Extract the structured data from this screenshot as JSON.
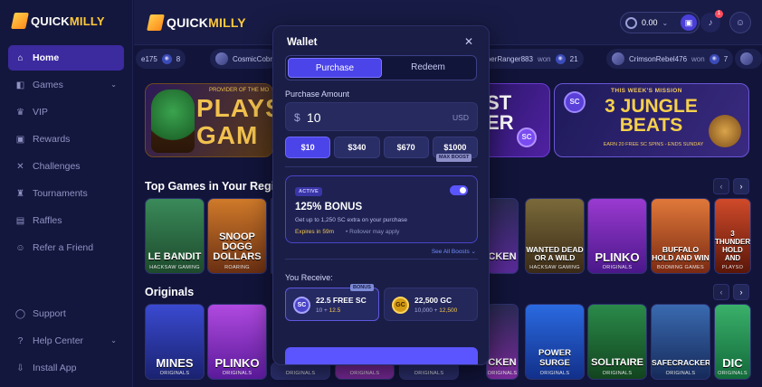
{
  "brand": {
    "name_a": "QUICK",
    "name_b": "MILLY"
  },
  "sidebar": {
    "items": [
      {
        "label": "Home",
        "icon": "home-icon"
      },
      {
        "label": "Games",
        "icon": "gamepad-icon"
      },
      {
        "label": "VIP",
        "icon": "crown-icon"
      },
      {
        "label": "Rewards",
        "icon": "gift-icon"
      },
      {
        "label": "Challenges",
        "icon": "swords-icon"
      },
      {
        "label": "Tournaments",
        "icon": "trophy-icon"
      },
      {
        "label": "Raffles",
        "icon": "ticket-icon"
      },
      {
        "label": "Refer a Friend",
        "icon": "user-plus-icon"
      }
    ],
    "bottom": [
      {
        "label": "Support",
        "icon": "chat-icon"
      },
      {
        "label": "Help Center",
        "icon": "help-icon"
      },
      {
        "label": "Install App",
        "icon": "download-icon"
      }
    ]
  },
  "topbar": {
    "balance": "0.00",
    "notification_count": "1"
  },
  "ticker": [
    {
      "user": "e175",
      "won": "won",
      "amount": "8"
    },
    {
      "user": "CosmicCobr",
      "won": "won",
      "amount": ""
    },
    {
      "user": "HyperRanger883",
      "won": "won",
      "amount": "21"
    },
    {
      "user": "CrimsonRebel476",
      "won": "won",
      "amount": "7"
    }
  ],
  "banners": {
    "b1_kicker": "PROVIDER OF THE MO",
    "b1_line1": "PLAYS",
    "b1_line2": "GAM",
    "b2_line1": "ST",
    "b2_line2": "ER",
    "b3_kicker": "THIS WEEK'S MISSION",
    "b3_line1": "3 JUNGLE",
    "b3_line2": "BEATS",
    "b3_foot": "EARN 20 FREE SC SPINS - ENDS SUNDAY",
    "sc": "SC"
  },
  "sections": {
    "top_games": "Top Games in Your Regio",
    "originals": "Originals"
  },
  "top_games": [
    {
      "title": "LE BANDIT",
      "sub": "HACKSAW GAMING"
    },
    {
      "title": "SNOOP DOGG DOLLARS",
      "sub": "ROARING"
    },
    {
      "title": "CKEN",
      "sub": "ORIGINALS"
    },
    {
      "title": "WANTED DEAD OR A WILD",
      "sub": "HACKSAW GAMING"
    },
    {
      "title": "PLINKO",
      "sub": "ORIGINALS"
    },
    {
      "title": "BUFFALO HOLD AND WIN",
      "sub": "BOOMING GAMES"
    },
    {
      "title": "3 THUNDER HOLD AND",
      "sub": "PLAYSO"
    }
  ],
  "originals": [
    {
      "title": "MINES",
      "sub": "ORIGINALS"
    },
    {
      "title": "PLINKO",
      "sub": "ORIGINALS"
    },
    {
      "title": "",
      "sub": "ORIGINALS"
    },
    {
      "title": "",
      "sub": "ORIGINALS"
    },
    {
      "title": "",
      "sub": "ORIGINALS"
    },
    {
      "title": "CKEN",
      "sub": "ORIGINALS"
    },
    {
      "title": "POWER SURGE",
      "sub": "ORIGINALS"
    },
    {
      "title": "SOLITAIRE",
      "sub": "ORIGINALS"
    },
    {
      "title": "SAFECRACKER",
      "sub": "ORIGINALS"
    },
    {
      "title": "DIC",
      "sub": "ORIGINALS"
    }
  ],
  "wallet": {
    "title": "Wallet",
    "tabs": [
      "Purchase",
      "Redeem"
    ],
    "amount_label": "Purchase Amount",
    "currency_symbol": "$",
    "amount": "10",
    "unit": "USD",
    "presets": [
      "$10",
      "$340",
      "$670",
      "$1000"
    ],
    "max_boost": "MAX BOOST",
    "boost": {
      "tag": "ACTIVE",
      "title": "125% BONUS",
      "desc": "Get up to 1,250 SC extra on your purchase",
      "expires": "Expires in 59m",
      "rollover": "•  Rollover may apply",
      "enabled": true
    },
    "see_all": "See All Boosts ⌄",
    "receive_label": "You Receive:",
    "bonus_tag": "BONUS",
    "sc": {
      "icon": "SC",
      "main": "22.5 FREE SC",
      "base": "10 + ",
      "extra": "12.5"
    },
    "gc": {
      "icon": "GC",
      "main": "22,500 GC",
      "base": "10,000 + ",
      "extra": "12,500"
    }
  }
}
